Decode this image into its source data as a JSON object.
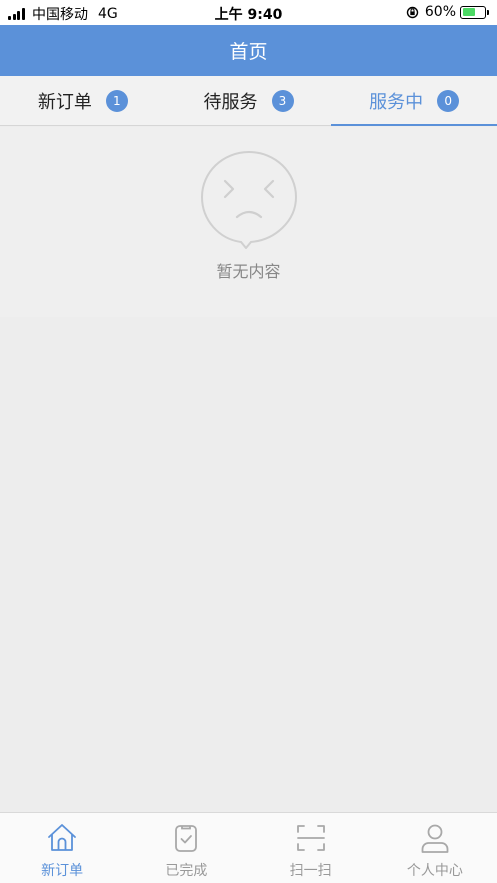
{
  "status_bar": {
    "carrier": "中国移动",
    "network": "4G",
    "time": "上午 9:40",
    "battery": "60%",
    "battery_level": 0.6
  },
  "header": {
    "title": "首页"
  },
  "tabs": [
    {
      "label": "新订单",
      "count": "1",
      "active": false
    },
    {
      "label": "待服务",
      "count": "3",
      "active": false
    },
    {
      "label": "服务中",
      "count": "0",
      "active": true
    }
  ],
  "empty_state": {
    "icon": "sad-face-bubble-icon",
    "text": "暂无内容"
  },
  "bottom_nav": [
    {
      "label": "新订单",
      "icon": "home-icon",
      "active": true
    },
    {
      "label": "已完成",
      "icon": "clipboard-check-icon",
      "active": false
    },
    {
      "label": "扫一扫",
      "icon": "scan-icon",
      "active": false
    },
    {
      "label": "个人中心",
      "icon": "user-icon",
      "active": false
    }
  ],
  "colors": {
    "accent": "#5b91d9",
    "background": "#ededed",
    "inactive": "#999999"
  }
}
